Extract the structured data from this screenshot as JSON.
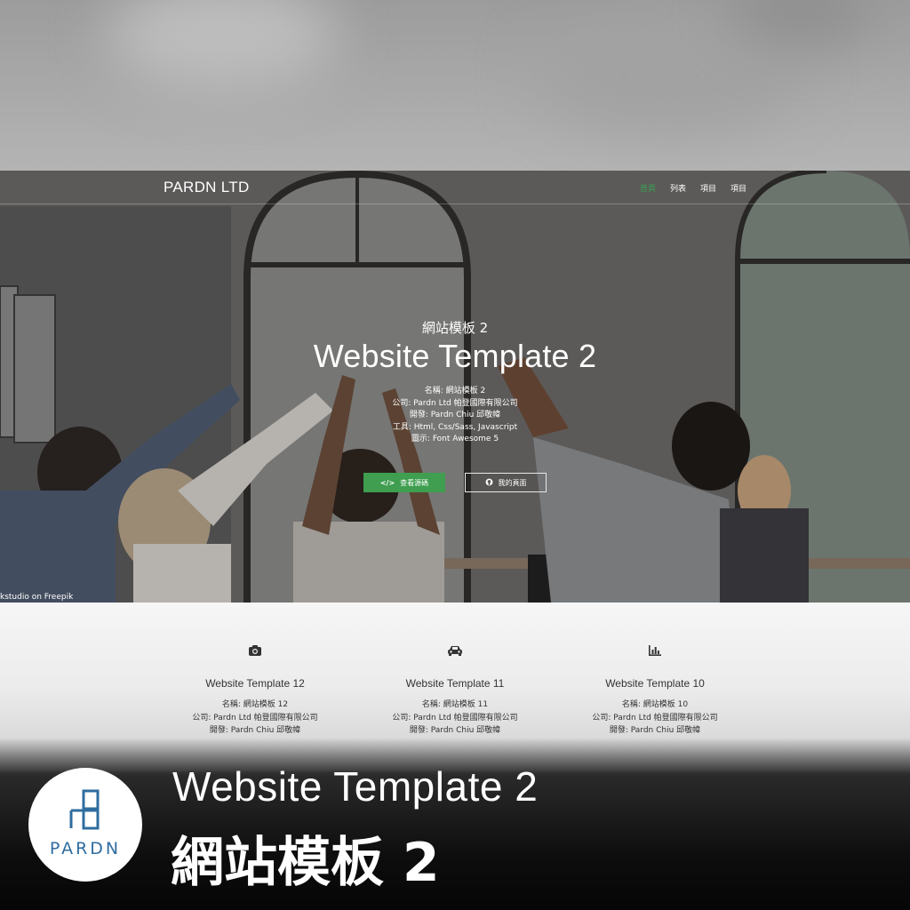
{
  "navbar": {
    "brand": "PARDN LTD",
    "links": [
      "首頁",
      "列表",
      "項目",
      "項目"
    ]
  },
  "hero": {
    "subtitle": "網站模板 2",
    "title": "Website Template 2",
    "meta": [
      "名稱: 網站模板 2",
      "公司: Pardn Ltd 帕登國際有限公司",
      "開發: Pardn Chiu 邱敬幃",
      "工具: Html, Css/Sass, Javascript",
      "圖示: Font Awesome 5"
    ],
    "buttons": {
      "source": "查看源碼",
      "homepage": "我的頁面"
    },
    "credit": "kstudio on Freepik"
  },
  "cards": [
    {
      "icon": "camera-icon",
      "title": "Website Template 12",
      "meta": [
        "名稱: 網站模板 12",
        "公司: Pardn Ltd 帕登國際有限公司",
        "開發: Pardn Chiu 邱敬幃"
      ]
    },
    {
      "icon": "car-icon",
      "title": "Website Template 11",
      "meta": [
        "名稱: 網站模板 11",
        "公司: Pardn Ltd 帕登國際有限公司",
        "開發: Pardn Chiu 邱敬幃"
      ]
    },
    {
      "icon": "chart-bar-icon",
      "title": "Website Template 10",
      "meta": [
        "名稱: 網站模板 10",
        "公司: Pardn Ltd 帕登國際有限公司",
        "開發: Pardn Chiu 邱敬幃"
      ]
    }
  ],
  "footer": {
    "logo_text": "PARDN",
    "title_en": "Website Template 2",
    "title_zh": "網站模板 2"
  },
  "colors": {
    "accent_green": "#3f9e4f",
    "logo_blue": "#2f6da0"
  }
}
